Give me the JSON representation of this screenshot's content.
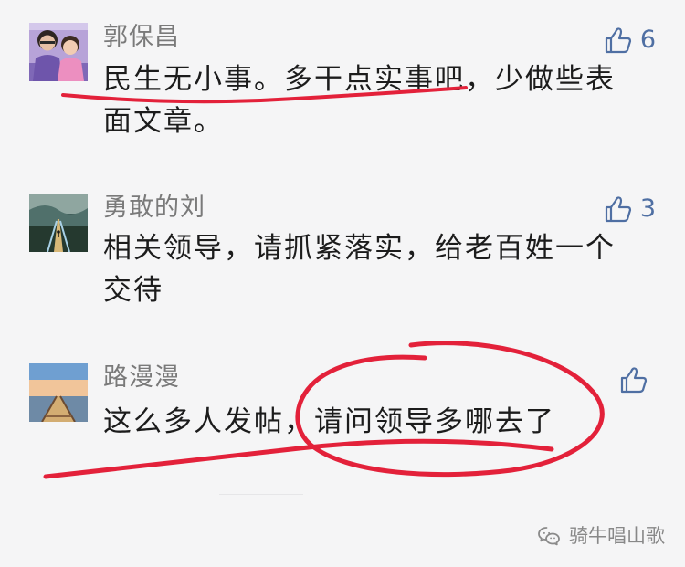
{
  "comments": [
    {
      "author": "郭保昌",
      "text": "民生无小事。多干点实事吧，少做些表面文章。",
      "likes": "6",
      "avatar": "family-photo-avatar"
    },
    {
      "author": "勇敢的刘",
      "text": "相关领导，请抓紧落实，给老百姓一个交待",
      "likes": "3",
      "avatar": "bridge-to-sea-avatar"
    },
    {
      "author": "路漫漫",
      "text": "这么多人发帖，请问领导多哪去了",
      "likes": "",
      "avatar": "pier-sunset-avatar"
    }
  ],
  "watermark": {
    "text": "骑牛唱山歌",
    "icon": "wechat-icon"
  },
  "colors": {
    "background": "#f5f5f6",
    "author": "#7a7a7a",
    "text": "#1c1c1c",
    "like": "#4f6fa3",
    "annotation": "#e3213a"
  }
}
